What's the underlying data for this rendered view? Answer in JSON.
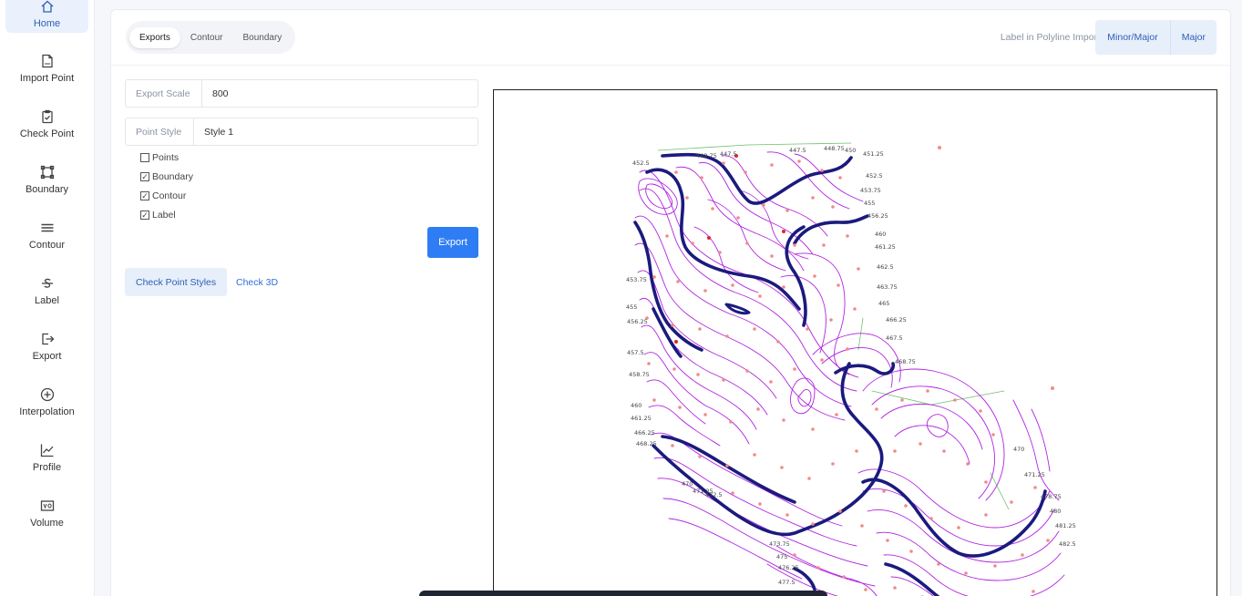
{
  "sidebar": {
    "items": [
      {
        "label": "Home",
        "icon": "home-icon"
      },
      {
        "label": "Import Point",
        "icon": "file-csv-icon"
      },
      {
        "label": "Check Point",
        "icon": "clipboard-check-icon"
      },
      {
        "label": "Boundary",
        "icon": "boundary-square-icon"
      },
      {
        "label": "Contour",
        "icon": "contour-lines-icon"
      },
      {
        "label": "Label",
        "icon": "strikethrough-s-icon"
      },
      {
        "label": "Export",
        "icon": "export-icon"
      },
      {
        "label": "Interpolation",
        "icon": "plus-circle-icon"
      },
      {
        "label": "Profile",
        "icon": "line-chart-icon"
      },
      {
        "label": "Volume",
        "icon": "volume-vo-icon"
      }
    ]
  },
  "toolbar": {
    "tabs": [
      {
        "label": "Exports",
        "active": true
      },
      {
        "label": "Contour",
        "active": false
      },
      {
        "label": "Boundary",
        "active": false
      }
    ],
    "label_import": "Label in Polyline Import",
    "buttons": [
      "Minor/Major",
      "Major"
    ]
  },
  "form": {
    "export_scale_label": "Export Scale",
    "export_scale_value": "800",
    "point_style_label": "Point Style",
    "point_style_value": "Style 1",
    "checkboxes": [
      {
        "label": "Points",
        "checked": false
      },
      {
        "label": "Boundary",
        "checked": true
      },
      {
        "label": "Contour",
        "checked": true
      },
      {
        "label": "Label",
        "checked": true
      }
    ],
    "export_button": "Export"
  },
  "subtabs": {
    "active": "Check Point Styles",
    "link": "Check 3D"
  },
  "map": {
    "contour_labels": [
      "452.5",
      "448.75",
      "447.5",
      "447.5",
      "448.75",
      "450",
      "451.25",
      "452.5",
      "453.75",
      "455",
      "456.25",
      "460",
      "461.25",
      "462.5",
      "463.75",
      "465",
      "466.25",
      "467.5",
      "468.75",
      "470",
      "471.25",
      "472.5",
      "473.75",
      "475",
      "476.25",
      "477.5",
      "478.75",
      "480",
      "481.25",
      "482.5",
      "470",
      "471.25",
      "453.75",
      "455",
      "456.25",
      "457.5",
      "458.75",
      "460",
      "461.25",
      "466.25",
      "468.25"
    ],
    "colors": {
      "minor": "#b224e0",
      "major": "#1a1a7e",
      "points": "#f28a8a",
      "boundary": "#6cc16c"
    }
  }
}
